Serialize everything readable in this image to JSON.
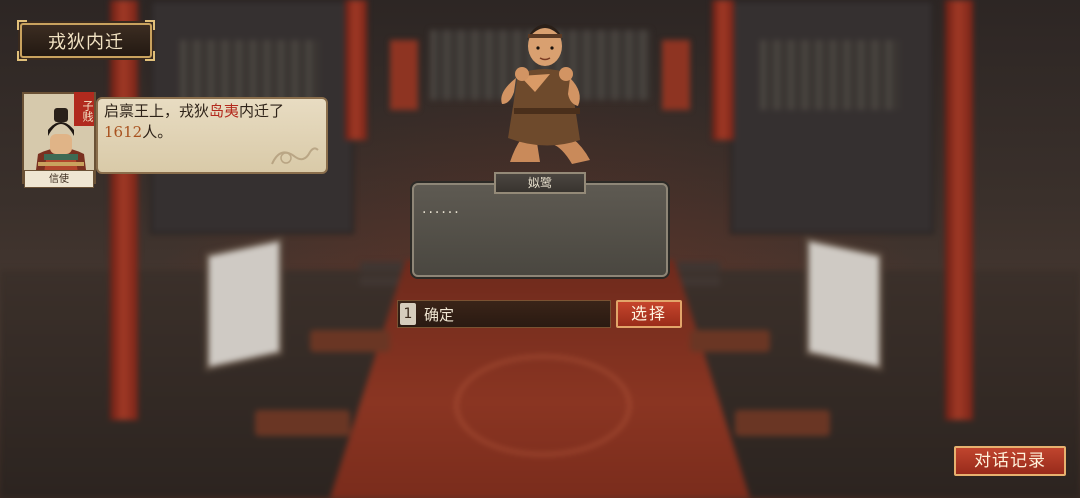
{
  "title_plaque": "戎狄内迁",
  "speaker": {
    "seal": "子贱",
    "role": "信使",
    "message_before": "启禀王上，戎狄",
    "message_highlight": "岛夷",
    "message_after": "内迁了",
    "count": "1612",
    "count_suffix": "人。"
  },
  "character": {
    "name": "姒鹭"
  },
  "dialog": {
    "text": "······"
  },
  "choice": {
    "index": "1",
    "label": "确定",
    "select_label": "选择"
  },
  "log_button": "对话记录",
  "colors": {
    "accent_red": "#b3291d",
    "gold_border": "#c9a25e"
  }
}
